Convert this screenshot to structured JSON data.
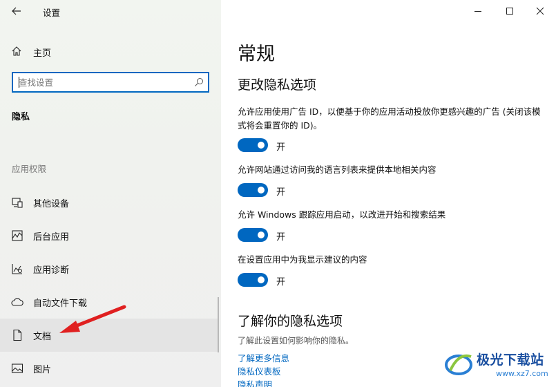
{
  "window": {
    "title": "设置",
    "controls": [
      "minimize-icon",
      "maximize-icon",
      "close-icon"
    ]
  },
  "sidebar": {
    "home_label": "主页",
    "search_placeholder": "查找设置",
    "section_title": "隐私",
    "group_label": "应用权限",
    "items": [
      {
        "label": "其他设备",
        "icon": "other-devices-icon"
      },
      {
        "label": "后台应用",
        "icon": "background-apps-icon"
      },
      {
        "label": "应用诊断",
        "icon": "app-diagnostics-icon"
      },
      {
        "label": "自动文件下载",
        "icon": "cloud-download-icon"
      },
      {
        "label": "文档",
        "icon": "document-icon",
        "selected": true
      },
      {
        "label": "图片",
        "icon": "picture-icon"
      }
    ]
  },
  "main": {
    "page_title": "常规",
    "sub_title": "更改隐私选项",
    "options": [
      {
        "desc": "允许应用使用广告 ID，以便基于你的应用活动投放你更感兴趣的广告 (关闭该模式将会重置你的 ID)。",
        "state": "开",
        "on": true
      },
      {
        "desc": "允许网站通过访问我的语言列表来提供本地相关内容",
        "state": "开",
        "on": true
      },
      {
        "desc": "允许 Windows 跟踪应用启动，以改进开始和搜索结果",
        "state": "开",
        "on": true
      },
      {
        "desc": "在设置应用中为我显示建议的内容",
        "state": "开",
        "on": true
      }
    ],
    "learn_title": "了解你的隐私选项",
    "learn_desc": "了解此设置如何影响你的隐私。",
    "links": [
      "了解更多信息",
      "隐私仪表板",
      "隐私声明"
    ]
  },
  "watermark": {
    "brand": "极光下载站",
    "url": "www.xz7.com"
  },
  "colors": {
    "accent": "#0067c0",
    "annotation": "#e02020"
  }
}
